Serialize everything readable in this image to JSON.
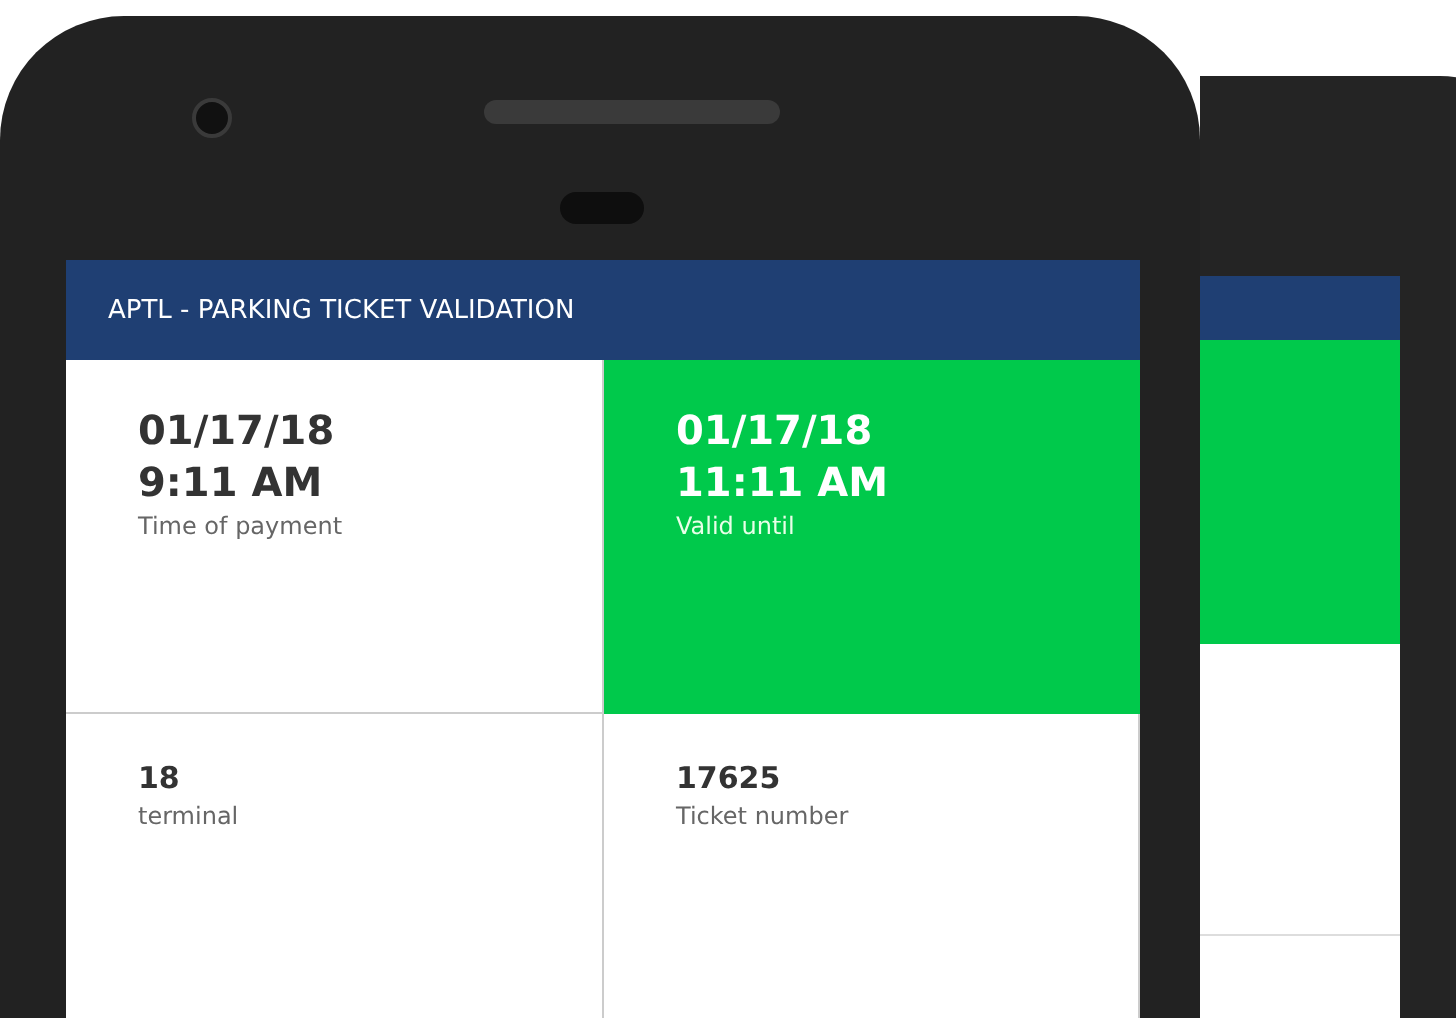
{
  "app": {
    "title": "APTL - PARKING TICKET VALIDATION"
  },
  "tiles": [
    {
      "kind": "large",
      "value_lines": [
        "01/17/18",
        "9:11 AM"
      ],
      "label": "Time of payment",
      "highlighted": false
    },
    {
      "kind": "large",
      "value_lines": [
        "01/17/18",
        "11:11 AM"
      ],
      "label": "Valid until",
      "highlighted": true
    },
    {
      "kind": "small",
      "value_lines": [
        "18"
      ],
      "label": "terminal",
      "highlighted": false
    },
    {
      "kind": "small",
      "value_lines": [
        "17625"
      ],
      "label": "Ticket number",
      "highlighted": false
    }
  ]
}
